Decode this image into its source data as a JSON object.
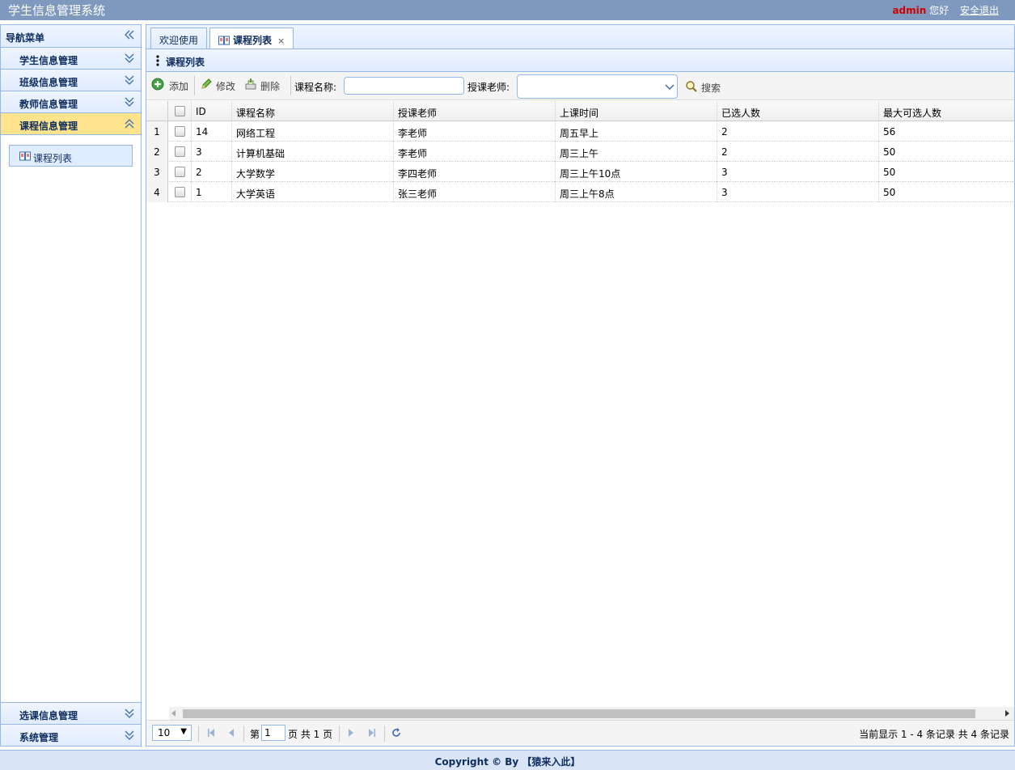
{
  "header": {
    "app_title": "学生信息管理系统",
    "username": "admin",
    "greeting": "您好",
    "logout_label": "安全退出"
  },
  "nav": {
    "title": "导航菜单",
    "sections": [
      {
        "label": "学生信息管理",
        "expanded": false
      },
      {
        "label": "班级信息管理",
        "expanded": false
      },
      {
        "label": "教师信息管理",
        "expanded": false
      },
      {
        "label": "课程信息管理",
        "expanded": true
      },
      {
        "label": "选课信息管理",
        "expanded": false
      },
      {
        "label": "系统管理",
        "expanded": false
      }
    ],
    "active_link": "课程列表"
  },
  "tabs": [
    {
      "label": "欢迎使用",
      "selected": false
    },
    {
      "label": "课程列表",
      "selected": true,
      "close": "×"
    }
  ],
  "panel": {
    "title": "课程列表",
    "toolbar": {
      "add_label": "添加",
      "edit_label": "修改",
      "delete_label": "删除",
      "course_name_label": "课程名称:",
      "course_name_value": "",
      "teacher_label": "授课老师:",
      "teacher_value": "",
      "search_label": "搜索"
    }
  },
  "table": {
    "columns": [
      "ID",
      "课程名称",
      "授课老师",
      "上课时间",
      "已选人数",
      "最大可选人数"
    ],
    "rows": [
      {
        "rownum": "1",
        "id": "14",
        "name": "网络工程",
        "teacher": "李老师",
        "time": "周五早上",
        "selected": "2",
        "max": "56"
      },
      {
        "rownum": "2",
        "id": "3",
        "name": "计算机基础",
        "teacher": "李老师",
        "time": "周三上午",
        "selected": "2",
        "max": "50"
      },
      {
        "rownum": "3",
        "id": "2",
        "name": "大学数学",
        "teacher": "李四老师",
        "time": "周三上午10点",
        "selected": "3",
        "max": "50"
      },
      {
        "rownum": "4",
        "id": "1",
        "name": "大学英语",
        "teacher": "张三老师",
        "time": "周三上午8点",
        "selected": "3",
        "max": "50"
      }
    ]
  },
  "pager": {
    "page_size": "10",
    "page_prefix": "第",
    "page_number": "1",
    "page_suffix": "页 共 1 页",
    "info": "当前显示 1 - 4 条记录 共 4 条记录"
  },
  "footer": {
    "text": "Copyright © By 【猿来入此】"
  },
  "colors": {
    "header_bg": "#7f99be",
    "border": "#95b8e7",
    "active_section": "#ffe48d",
    "username": "#cc0000"
  }
}
